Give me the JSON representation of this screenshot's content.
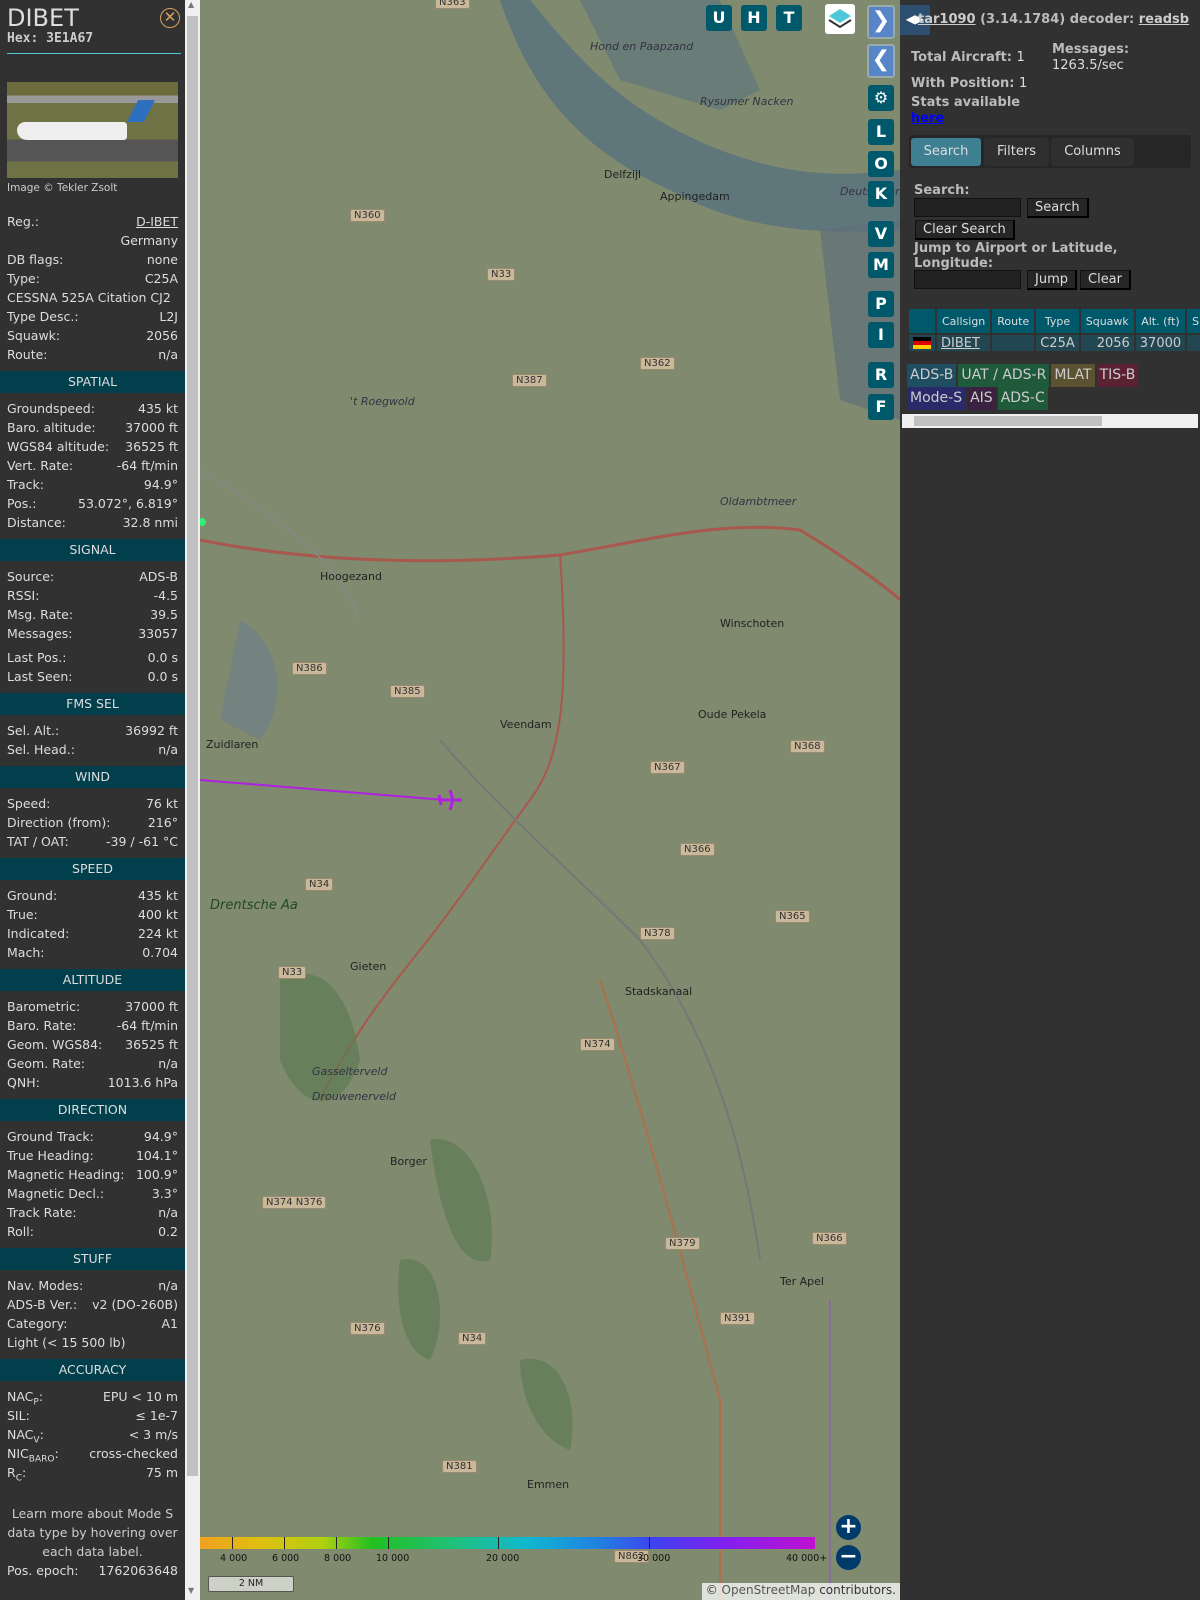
{
  "aircraft": {
    "callsign": "DIBET",
    "hex_label": "Hex: 3E1A67",
    "photo_credit": "Image © Tekler Zsolt"
  },
  "details": [
    {
      "type": "row",
      "label": "Reg.:",
      "value": "D-IBET",
      "link": true
    },
    {
      "type": "right",
      "value": "Germany"
    },
    {
      "type": "row",
      "label": "DB flags:",
      "value": "none"
    },
    {
      "type": "row",
      "label": "Type:",
      "value": "C25A"
    },
    {
      "type": "full",
      "value": "CESSNA 525A Citation CJ2"
    },
    {
      "type": "row",
      "label": "Type Desc.:",
      "value": "L2J"
    },
    {
      "type": "row",
      "label": "Squawk:",
      "value": "2056"
    },
    {
      "type": "row",
      "label": "Route:",
      "value": "n/a"
    },
    {
      "type": "section",
      "value": "SPATIAL"
    },
    {
      "type": "row",
      "label": "Groundspeed:",
      "value": "435 kt"
    },
    {
      "type": "row",
      "label": "Baro. altitude:",
      "value": "37000 ft"
    },
    {
      "type": "row",
      "label": "WGS84 altitude:",
      "value": "36525 ft"
    },
    {
      "type": "row",
      "label": "Vert. Rate:",
      "value": "-64 ft/min"
    },
    {
      "type": "row",
      "label": "Track:",
      "value": "94.9°"
    },
    {
      "type": "row",
      "label": "Pos.:",
      "value": "53.072°, 6.819°"
    },
    {
      "type": "row",
      "label": "Distance:",
      "value": "32.8 nmi"
    },
    {
      "type": "section",
      "value": "SIGNAL"
    },
    {
      "type": "row",
      "label": "Source:",
      "value": "ADS-B"
    },
    {
      "type": "row",
      "label": "RSSI:",
      "value": "-4.5"
    },
    {
      "type": "row",
      "label": "Msg. Rate:",
      "value": "39.5"
    },
    {
      "type": "row",
      "label": "Messages:",
      "value": "33057"
    },
    {
      "type": "gap"
    },
    {
      "type": "row",
      "label": "Last Pos.:",
      "value": "0.0 s"
    },
    {
      "type": "row",
      "label": "Last Seen:",
      "value": "0.0 s"
    },
    {
      "type": "section",
      "value": "FMS SEL"
    },
    {
      "type": "row",
      "label": "Sel. Alt.:",
      "value": "36992 ft"
    },
    {
      "type": "row",
      "label": "Sel. Head.:",
      "value": "n/a"
    },
    {
      "type": "section",
      "value": "WIND"
    },
    {
      "type": "row",
      "label": "Speed:",
      "value": "76 kt"
    },
    {
      "type": "row",
      "label": "Direction (from):",
      "value": "216°"
    },
    {
      "type": "row",
      "label": "TAT / OAT:",
      "value": "-39 / -61 °C"
    },
    {
      "type": "section",
      "value": "SPEED"
    },
    {
      "type": "row",
      "label": "Ground:",
      "value": "435 kt"
    },
    {
      "type": "row",
      "label": "True:",
      "value": "400 kt"
    },
    {
      "type": "row",
      "label": "Indicated:",
      "value": "224 kt"
    },
    {
      "type": "row",
      "label": "Mach:",
      "value": "0.704"
    },
    {
      "type": "section",
      "value": "ALTITUDE"
    },
    {
      "type": "row",
      "label": "Barometric:",
      "value": "37000 ft"
    },
    {
      "type": "row",
      "label": "Baro. Rate:",
      "value": "-64 ft/min"
    },
    {
      "type": "row",
      "label": "Geom. WGS84:",
      "value": "36525 ft"
    },
    {
      "type": "row",
      "label": "Geom. Rate:",
      "value": "n/a"
    },
    {
      "type": "row",
      "label": "QNH:",
      "value": "1013.6 hPa"
    },
    {
      "type": "section",
      "value": "DIRECTION"
    },
    {
      "type": "row",
      "label": "Ground Track:",
      "value": "94.9°"
    },
    {
      "type": "row",
      "label": "True Heading:",
      "value": "104.1°"
    },
    {
      "type": "row",
      "label": "Magnetic Heading:",
      "value": "100.9°"
    },
    {
      "type": "row",
      "label": "Magnetic Decl.:",
      "value": "3.3°"
    },
    {
      "type": "row",
      "label": "Track Rate:",
      "value": "n/a"
    },
    {
      "type": "row",
      "label": "Roll:",
      "value": "0.2"
    },
    {
      "type": "section",
      "value": "STUFF"
    },
    {
      "type": "row",
      "label": "Nav. Modes:",
      "value": "n/a"
    },
    {
      "type": "row",
      "label": "ADS-B Ver.:",
      "value": "v2 (DO-260B)"
    },
    {
      "type": "row",
      "label": "Category:",
      "value": "A1"
    },
    {
      "type": "full",
      "value": "Light (< 15 500 lb)"
    },
    {
      "type": "section",
      "value": "ACCURACY"
    },
    {
      "type": "row",
      "label": "NAC",
      "sub": "P",
      "value": "EPU < 10 m"
    },
    {
      "type": "row",
      "label": "SIL:",
      "value": "≤ 1e-7"
    },
    {
      "type": "row",
      "label": "NAC",
      "sub": "V",
      "value": "< 3 m/s"
    },
    {
      "type": "row",
      "label": "NIC",
      "sub": "BARO",
      "value": "cross-checked"
    },
    {
      "type": "row",
      "label": "R",
      "sub": "C",
      "value": "75 m"
    },
    {
      "type": "note",
      "value": "Learn more about Mode S data type by hovering over each data label."
    },
    {
      "type": "row",
      "label": "Pos. epoch:",
      "value": "1762063648"
    }
  ],
  "map": {
    "top_buttons": [
      "U",
      "H",
      "T"
    ],
    "side_buttons": [
      "L",
      "O",
      "K",
      "V",
      "M",
      "P",
      "I",
      "R",
      "F"
    ],
    "towns": [
      {
        "name": "Delfzijl"
      },
      {
        "name": "Appingedam"
      },
      {
        "name": "Hoogezand"
      },
      {
        "name": "Winschoten"
      },
      {
        "name": "Veendam"
      },
      {
        "name": "Oude Pekela"
      },
      {
        "name": "Zuidlaren"
      },
      {
        "name": "Gieten"
      },
      {
        "name": "Stadskanaal"
      },
      {
        "name": "Borger"
      },
      {
        "name": "Ter Apel"
      },
      {
        "name": "Emmen"
      },
      {
        "name": "Drentsche Aa"
      },
      {
        "name": "Rysumer Nacken"
      },
      {
        "name": "Hond en Paapzand"
      },
      {
        "name": "Deutschland"
      },
      {
        "name": "'t Roegwold"
      },
      {
        "name": "Oldambtmeer"
      },
      {
        "name": "Gasselterveld"
      },
      {
        "name": "Drouwenerveld"
      }
    ],
    "roads": [
      "N363",
      "N360",
      "N33",
      "N362",
      "N387",
      "N386",
      "N385",
      "N367",
      "N368",
      "N366",
      "N34",
      "N378",
      "N365",
      "N33",
      "N374",
      "N374 N376",
      "N379",
      "N366",
      "N391",
      "N376",
      "N34",
      "N381",
      "N862"
    ],
    "altitude_legend": [
      "4 000",
      "6 000",
      "8 000",
      "10 000",
      "20 000",
      "30 000",
      "40 000+"
    ],
    "scale": "2 NM",
    "attribution_prefix": "© ",
    "attribution_link": "OpenStreetMap",
    "attribution_suffix": " contributors."
  },
  "panel": {
    "app_link": "tar1090",
    "version": " (3.14.1784) decoder: ",
    "decoder_link": "readsb",
    "total_label": "Total Aircraft:",
    "total": "1",
    "position_label": "With Position:",
    "position": "1",
    "messages_label": "Messages:",
    "messages": "1263.5/sec",
    "stats_label": "Stats available",
    "stats_link": "here",
    "tabs": [
      "Search",
      "Filters",
      "Columns"
    ],
    "search_label": "Search:",
    "search_button": "Search",
    "clear_search": "Clear Search",
    "jump_label": "Jump to Airport or Latitude, Longitude:",
    "jump_button": "Jump",
    "clear_button": "Clear",
    "columns": [
      "",
      "Callsign",
      "Route",
      "Type",
      "Squawk",
      "Alt. (ft)",
      "Spd."
    ],
    "rows": [
      {
        "callsign": "DIBET",
        "route": "",
        "type": "C25A",
        "squawk": "2056",
        "alt": "37000",
        "spd": ""
      }
    ],
    "badges": [
      {
        "label": "ADS-B",
        "color": "#1f4e63"
      },
      {
        "label": "UAT / ADS-R",
        "color": "#1f5a3a"
      },
      {
        "label": "MLAT",
        "color": "#5a5230"
      },
      {
        "label": "TIS-B",
        "color": "#5a2233"
      },
      {
        "label": "Mode-S",
        "color": "#2a2a6a"
      },
      {
        "label": "AIS",
        "color": "#3a2240"
      },
      {
        "label": "ADS-C",
        "color": "#1f5a3a"
      }
    ]
  }
}
